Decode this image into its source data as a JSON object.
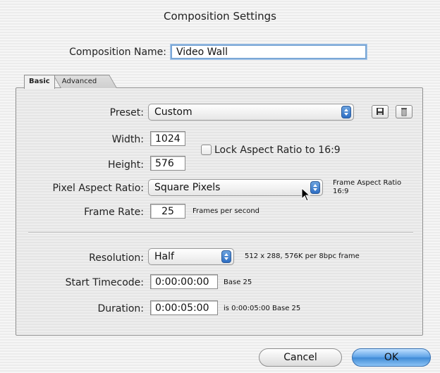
{
  "dialog": {
    "title": "Composition Settings"
  },
  "name_row": {
    "label": "Composition Name:",
    "value": "Video Wall"
  },
  "tabs": [
    {
      "label": "Basic",
      "active": true
    },
    {
      "label": "Advanced",
      "active": false
    }
  ],
  "preset": {
    "label": "Preset:",
    "value": "Custom",
    "save_icon": "floppy-disk-icon",
    "delete_icon": "trash-icon"
  },
  "width": {
    "label": "Width:",
    "value": "1024"
  },
  "height": {
    "label": "Height:",
    "value": "576"
  },
  "lock_aspect": {
    "label": "Lock Aspect Ratio to 16:9",
    "checked": false
  },
  "pixel_aspect": {
    "label": "Pixel Aspect Ratio:",
    "value": "Square Pixels",
    "frame_aspect_label": "Frame Aspect Ratio",
    "frame_aspect_value": "16:9"
  },
  "frame_rate": {
    "label": "Frame Rate:",
    "value": "25",
    "unit": "Frames per second"
  },
  "resolution": {
    "label": "Resolution:",
    "value": "Half",
    "info": "512 x 288, 576K per 8bpc frame"
  },
  "start_timecode": {
    "label": "Start Timecode:",
    "value": "0:00:00:00",
    "base": "Base 25"
  },
  "duration": {
    "label": "Duration:",
    "value": "0:00:05:00",
    "info": "is 0:00:05:00  Base 25"
  },
  "buttons": {
    "cancel": "Cancel",
    "ok": "OK"
  },
  "colors": {
    "focus_ring": "#7aa7d6",
    "ok_button": "#5aa0e6",
    "popup_arrows": "#2d6ec4"
  }
}
